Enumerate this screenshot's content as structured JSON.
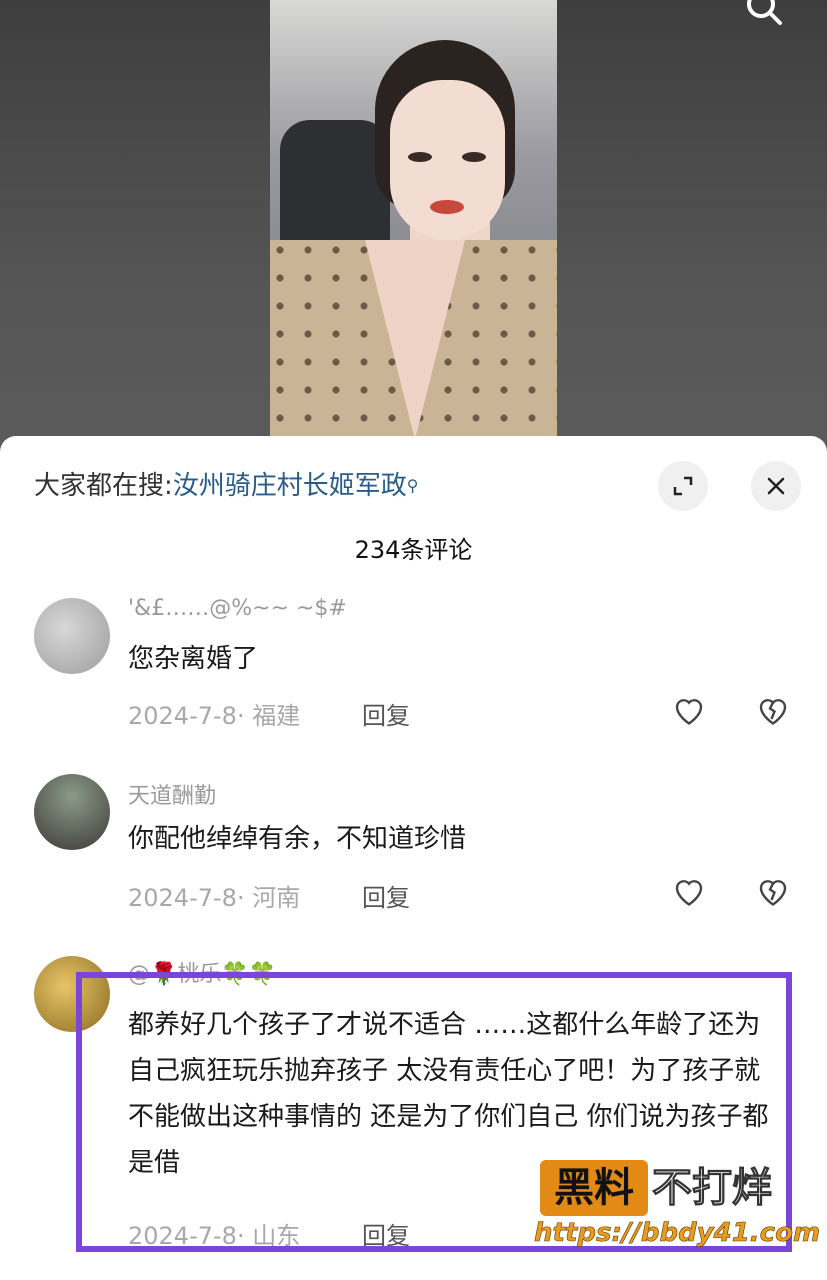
{
  "search_bar": {
    "prefix": "大家都在搜:",
    "keyword": "汝州骑庄村长姬军政"
  },
  "comment_count": "234条评论",
  "comments": [
    {
      "username": "'&£……@%~~ ~$#",
      "text": "您杂离婚了",
      "date_location": "2024-7-8· 福建",
      "reply_label": "回复"
    },
    {
      "username": "天道酬勤",
      "text": "你配他绰绰有余，不知道珍惜",
      "date_location": "2024-7-8· 河南",
      "reply_label": "回复"
    },
    {
      "username": "@🌹桃乐🍀🍀",
      "text": "都养好几个孩子了才说不适合 ……这都什么年龄了还为自己疯狂玩乐抛弃孩子  太没有责任心了吧！为了孩子就不能做出这种事情的  还是为了你们自己   你们说为孩子都是借",
      "date_location": "2024-7-8· 山东",
      "reply_label": "回复"
    }
  ],
  "watermark": {
    "badge": "黑料",
    "rest": "不打烊",
    "url": "https://bbdy41.com"
  },
  "colors": {
    "highlight_border": "#7a45d9",
    "keyword_link": "#2a5c8a",
    "watermark_orange": "#e28a14"
  },
  "icons": {
    "top_search": "search-icon",
    "expand": "expand-icon",
    "close": "close-icon",
    "like": "heart-icon",
    "dislike": "broken-heart-icon"
  }
}
